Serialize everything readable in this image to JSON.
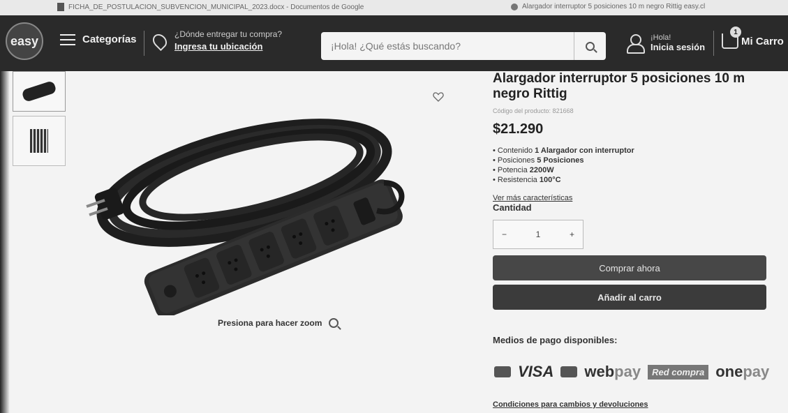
{
  "browser": {
    "tab1_title": "FICHA_DE_POSTULACION_SUBVENCION_MUNICIPAL_2023.docx - Documentos de Google",
    "tab2_title": "Alargador interruptor 5 posiciones 10 m negro Rittig easy.cl"
  },
  "header": {
    "logo_text": "easy",
    "categories_label": "Categorías",
    "location_question": "¿Dónde entregar tu compra?",
    "location_action": "Ingresa tu ubicación",
    "search_placeholder": "¡Hola! ¿Qué estás buscando?",
    "greeting": "¡Hola!",
    "login_label": "Inicia sesión",
    "cart_label": "Mi Carro",
    "cart_count": "1"
  },
  "gallery": {
    "zoom_hint": "Presiona para hacer zoom"
  },
  "product": {
    "title": "Alargador interruptor 5 posiciones 10 m negro Rittig",
    "code_label": "Código del producto: 821668",
    "price": "$21.290",
    "specs": [
      {
        "label": "Contenido",
        "value": "1 Alargador con interruptor"
      },
      {
        "label": "Posiciones",
        "value": "5 Posiciones"
      },
      {
        "label": "Potencia",
        "value": "2200W"
      },
      {
        "label": "Resistencia",
        "value": "100°C"
      }
    ],
    "more_link": "Ver más características",
    "quantity_label": "Cantidad",
    "quantity_value": "1",
    "minus": "−",
    "plus": "+",
    "buy_now": "Comprar ahora",
    "add_to_cart": "Añadir al carro"
  },
  "payment": {
    "title": "Medios de pago disponibles:",
    "visa": "VISA",
    "webpay_a": "web",
    "webpay_b": "pay",
    "redcompra": "Red compra",
    "onepay_a": "one",
    "onepay_b": "pay"
  },
  "conditions_link": "Condiciones para cambios y devoluciones"
}
